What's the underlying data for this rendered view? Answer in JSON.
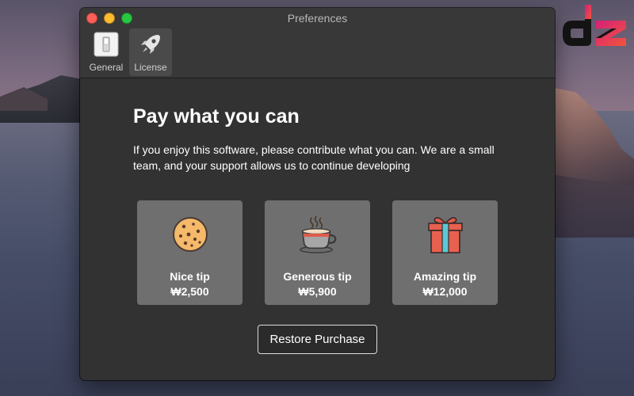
{
  "window": {
    "title": "Preferences"
  },
  "toolbar": {
    "items": [
      {
        "label": "General",
        "icon": "switch-icon",
        "active": false
      },
      {
        "label": "License",
        "icon": "rocket-icon",
        "active": true
      }
    ]
  },
  "main": {
    "heading": "Pay what you can",
    "description": "If you enjoy this software, please contribute what you can. We are a small team, and your support allows us to continue developing",
    "tips": [
      {
        "name": "Nice tip",
        "price": "₩2,500",
        "icon": "cookie-icon"
      },
      {
        "name": "Generous tip",
        "price": "₩5,900",
        "icon": "coffee-cup-icon"
      },
      {
        "name": "Amazing tip",
        "price": "₩12,000",
        "icon": "gift-icon"
      }
    ],
    "restore_label": "Restore Purchase"
  },
  "logo": {
    "text": "dz",
    "colors": [
      "#e0267a",
      "#f04a3c"
    ]
  },
  "colors": {
    "window_bg": "#323232",
    "tip_card_bg": "#6f6f6f",
    "close": "#ff5f57",
    "minimize": "#febc2e",
    "zoom": "#28c840"
  }
}
